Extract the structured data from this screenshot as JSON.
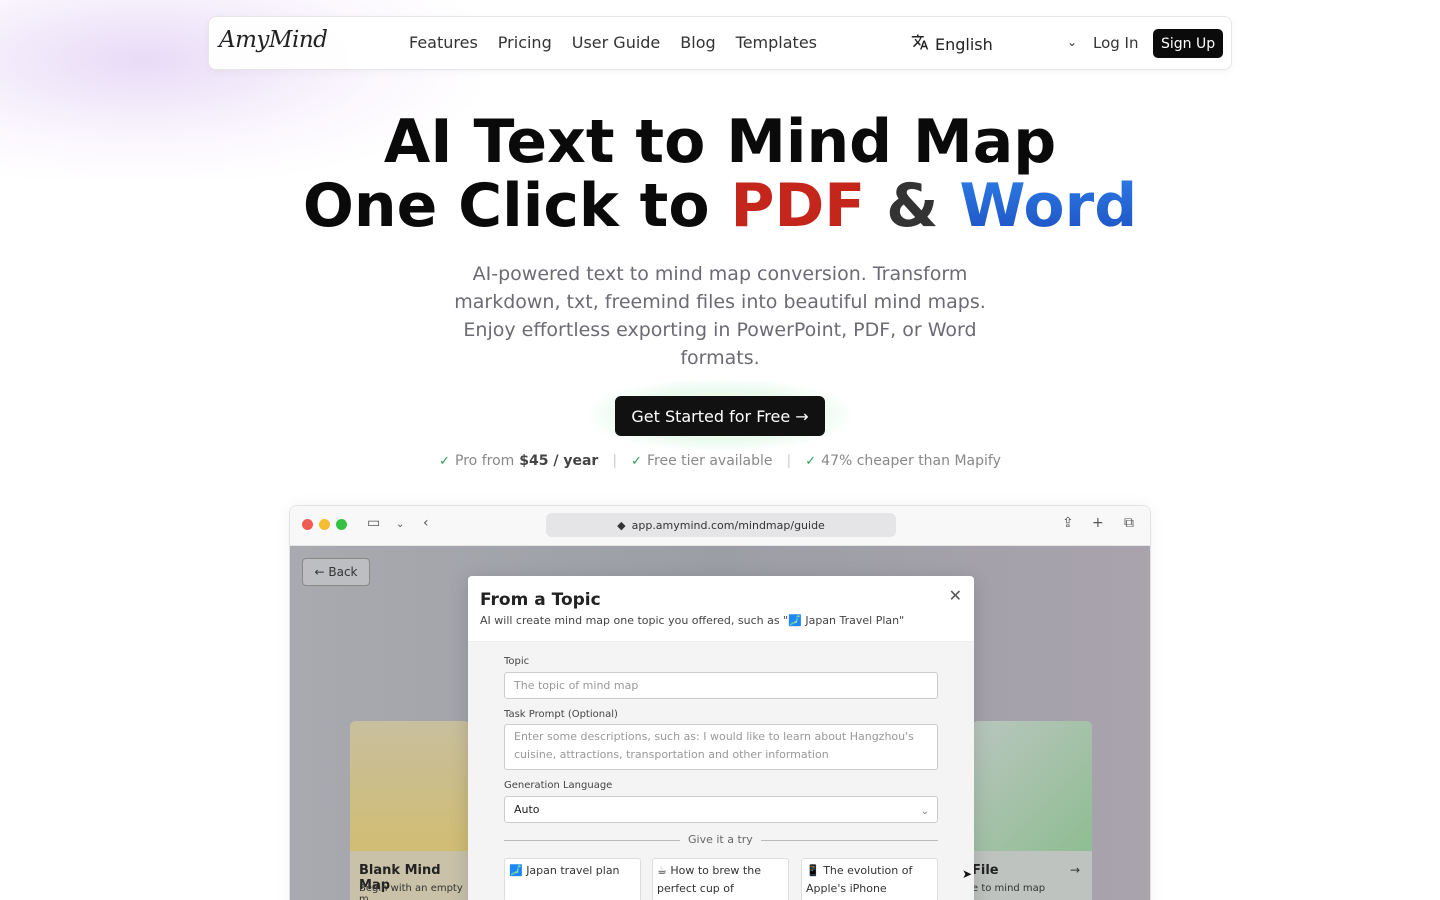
{
  "nav": {
    "logo": "AmyMind",
    "links": [
      "Features",
      "Pricing",
      "User Guide",
      "Blog",
      "Templates"
    ],
    "language": "English",
    "login": "Log In",
    "signup": "Sign Up"
  },
  "hero": {
    "line1": "AI Text to Mind Map",
    "line2_prefix": "One Click to ",
    "line2_pdf": "PDF",
    "line2_amp": " & ",
    "line2_word": "Word",
    "subtitle": "AI-powered text to mind map conversion. Transform markdown, txt, freemind files into beautiful mind maps. Enjoy effortless exporting in PowerPoint, PDF, or Word formats.",
    "cta": "Get Started for Free →",
    "perks": {
      "p1_prefix": "Pro from ",
      "p1_bold": "$45 / year",
      "p2": "Free tier available",
      "p3": "47% cheaper than Mapify"
    }
  },
  "browser": {
    "url": "app.amymind.com/mindmap/guide",
    "back": "← Back",
    "card_left": {
      "title": "Blank Mind Map",
      "desc": "Begin with an empty m"
    },
    "card_right": {
      "title": "File",
      "desc": "e to mind map"
    },
    "modal": {
      "title": "From a Topic",
      "desc": "AI will create mind map one topic you offered, such as \"🗾 Japan Travel Plan\"",
      "topic_label": "Topic",
      "topic_placeholder": "The topic of mind map",
      "prompt_label": "Task Prompt (Optional)",
      "prompt_placeholder": "Enter some descriptions, such as: I would like to learn about Hangzhou's cuisine, attractions, transportation and other information",
      "lang_label": "Generation Language",
      "lang_value": "Auto",
      "divider": "Give it a try",
      "suggestions": [
        "🗾 Japan travel plan",
        "☕ How to brew the perfect cup of espresso",
        "📱 The evolution of Apple's iPhone"
      ]
    }
  },
  "colors": {
    "pdf": "#c4261c",
    "word": "#1d4fc0",
    "check": "#2f9e56"
  }
}
